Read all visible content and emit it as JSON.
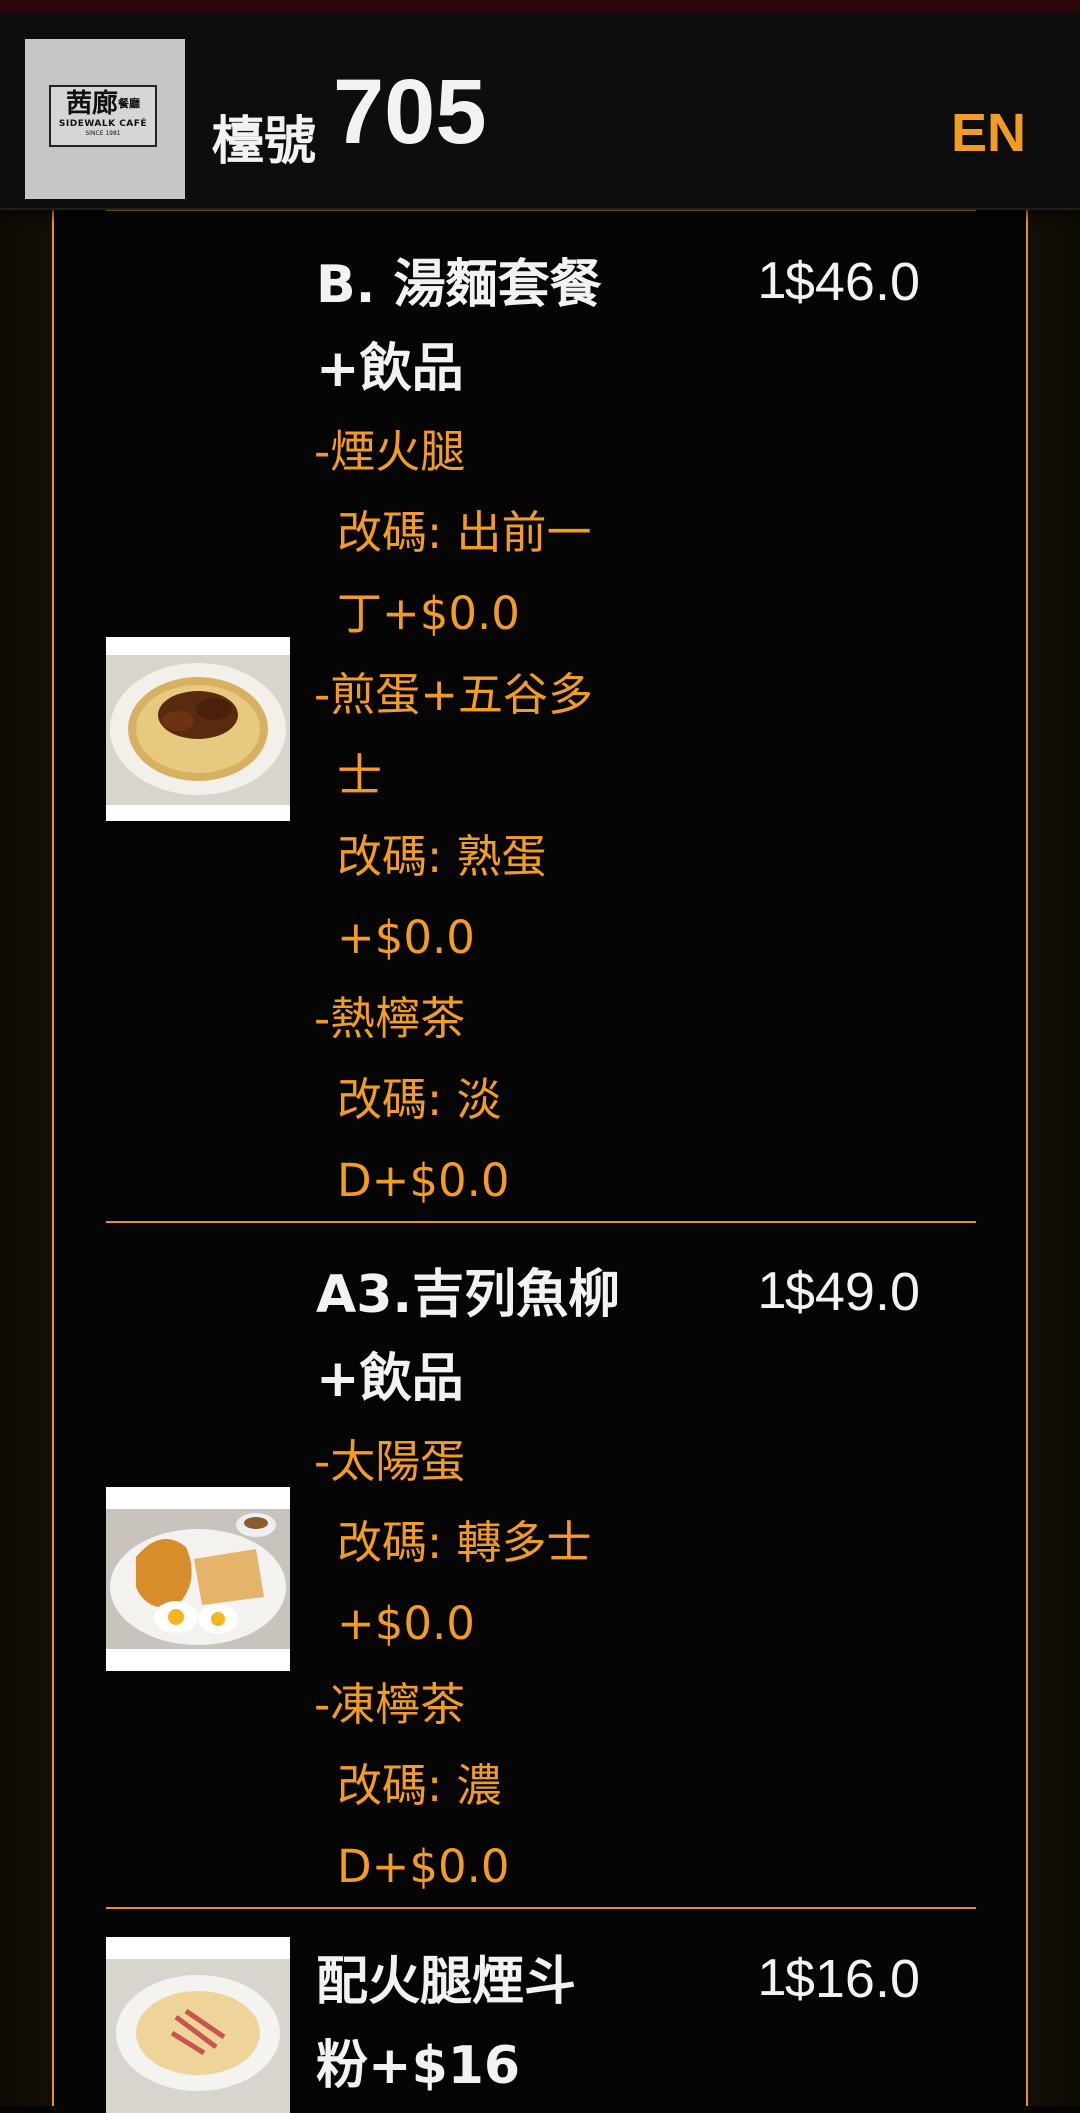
{
  "header": {
    "logo_cn": "茜廊",
    "logo_cn_small": "餐廳",
    "logo_en": "SIDEWALK CAFÉ",
    "logo_since": "SINCE 1981",
    "table_label": "檯號",
    "table_number": "705",
    "lang_button": "EN"
  },
  "items": [
    {
      "name_line1": "B. 湯麵套餐",
      "name_line2": "+飲品",
      "qty": "1",
      "price": "$46.0",
      "options": [
        {
          "text": "-煙火腿",
          "indent": false
        },
        {
          "text": "改碼: 出前一",
          "indent": true
        },
        {
          "text": "丁+$0.0",
          "indent": true
        },
        {
          "text": "-煎蛋+五谷多",
          "indent": false
        },
        {
          "text": "士",
          "indent": true
        },
        {
          "text": "改碼: 熟蛋",
          "indent": true
        },
        {
          "text": "+$0.0",
          "indent": true
        },
        {
          "text": "-熱檸茶",
          "indent": false
        },
        {
          "text": "改碼: 淡",
          "indent": true
        },
        {
          "text": "D+$0.0",
          "indent": true
        }
      ]
    },
    {
      "name_line1": "A3.吉列魚柳",
      "name_line2": "+飲品",
      "qty": "1",
      "price": "$49.0",
      "options": [
        {
          "text": "-太陽蛋",
          "indent": false
        },
        {
          "text": "改碼: 轉多士",
          "indent": true
        },
        {
          "text": "+$0.0",
          "indent": true
        },
        {
          "text": "-凍檸茶",
          "indent": false
        },
        {
          "text": "改碼: 濃",
          "indent": true
        },
        {
          "text": "D+$0.0",
          "indent": true
        }
      ]
    },
    {
      "name_line1": "配火腿煙斗",
      "name_line2": "粉+$16",
      "qty": "1",
      "price": "$16.0",
      "options": []
    }
  ]
}
